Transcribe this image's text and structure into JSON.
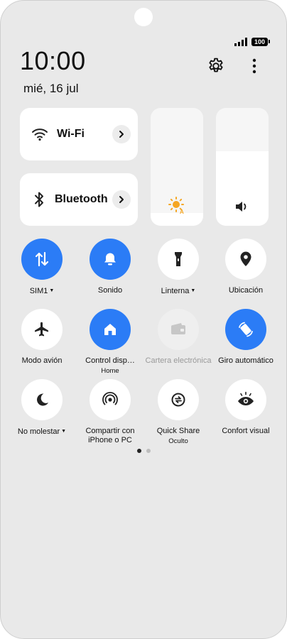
{
  "status": {
    "battery": "100"
  },
  "header": {
    "time": "10:00",
    "date": "mié, 16 jul"
  },
  "cards": {
    "wifi": {
      "label": "Wi-Fi"
    },
    "bluetooth": {
      "label": "Bluetooth"
    }
  },
  "sliders": {
    "brightness": {
      "level": 0.11,
      "icon": "auto-brightness-icon"
    },
    "volume": {
      "level": 0.63,
      "icon": "speaker-icon"
    }
  },
  "tiles": {
    "sim": {
      "label": "SIM1",
      "active": true
    },
    "sound": {
      "label": "Sonido",
      "active": true
    },
    "flashlight": {
      "label": "Linterna",
      "active": false
    },
    "location": {
      "label": "Ubicación",
      "active": false
    },
    "airplane": {
      "label": "Modo avión",
      "active": false
    },
    "device_control": {
      "label": "Control disp…",
      "sub": "Home",
      "active": true
    },
    "wallet": {
      "label": "Cartera electrónica",
      "active": false,
      "disabled": true
    },
    "rotation": {
      "label": "Giro automático",
      "active": true
    },
    "dnd": {
      "label": "No molestar",
      "active": false
    },
    "share_pc": {
      "label": "Compartir con iPhone o PC",
      "active": false
    },
    "quick_share": {
      "label": "Quick Share",
      "sub": "Oculto",
      "active": false
    },
    "eye_comfort": {
      "label": "Confort visual",
      "active": false
    }
  },
  "pager": {
    "pages": 2,
    "current": 1
  },
  "colors": {
    "accent": "#2b7cf6",
    "panel": "#e9e9e9",
    "tile": "#ffffff",
    "brightness": "#f5a623"
  }
}
